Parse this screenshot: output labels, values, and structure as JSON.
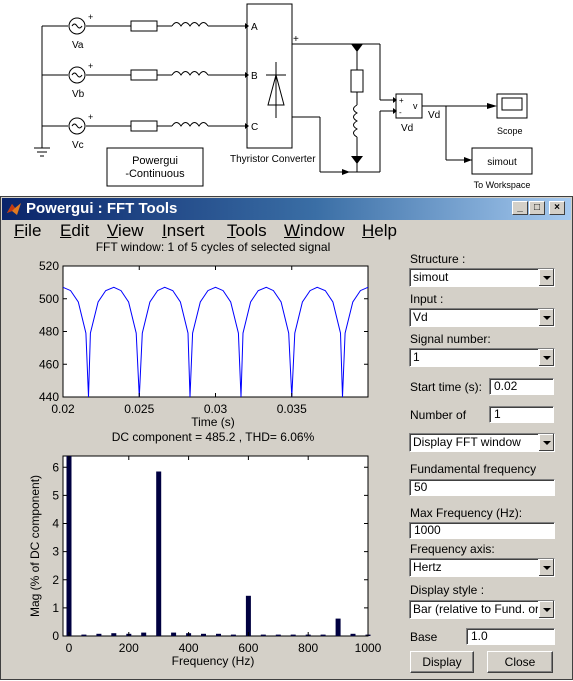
{
  "model": {
    "sources": [
      "Va",
      "Vb",
      "Vc"
    ],
    "converter_label": "Thyristor Converter",
    "ports": [
      "A",
      "B",
      "C"
    ],
    "plus_sign": "+",
    "minus_sign": "-",
    "powergui_line1": "Powergui",
    "powergui_line2": "-Continuous",
    "meter_label": "Vd",
    "meter_inner": "v",
    "signal_label": "Vd",
    "scope_label": "Scope",
    "workspace_block_text": "simout",
    "workspace_label": "To Workspace"
  },
  "window": {
    "title": "Powergui : FFT Tools",
    "menus": [
      "File",
      "Edit",
      "View",
      "Insert",
      "Tools",
      "Window",
      "Help"
    ]
  },
  "plots": {
    "top_title": "FFT window: 1 of 5 cycles of selected signal",
    "top_xlabel": "Time (s)",
    "bottom_title": "DC component = 485.2 , THD= 6.06%",
    "bottom_xlabel": "Frequency (Hz)",
    "bottom_ylabel": "Mag (% of DC component)"
  },
  "panel": {
    "structure_label": "Structure :",
    "structure_value": "simout",
    "input_label": "Input :",
    "input_value": "Vd",
    "signal_number_label": "Signal number:",
    "signal_number_value": "1",
    "start_time_label": "Start time (s):",
    "start_time_value": "0.02",
    "number_of_label": "Number of",
    "number_of_value": "1",
    "display_mode_value": "Display FFT window",
    "fundamental_label": "Fundamental frequency",
    "fundamental_value": "50",
    "max_freq_label": "Max Frequency (Hz):",
    "max_freq_value": "1000",
    "freq_axis_label": "Frequency axis:",
    "freq_axis_value": "Hertz",
    "display_style_label": "Display style :",
    "display_style_value": "Bar (relative to Fund. or DC)",
    "base_label": "Base",
    "base_value": "1.0",
    "display_button": "Display",
    "close_button": "Close"
  },
  "chart_data": [
    {
      "type": "line",
      "title": "FFT window: 1 of 5 cycles of selected signal",
      "xlabel": "Time (s)",
      "ylabel": "",
      "xlim": [
        0.02,
        0.04
      ],
      "ylim": [
        440,
        520
      ],
      "xticks": [
        "0.02",
        "0.025",
        "0.03",
        "0.035"
      ],
      "yticks": [
        "440",
        "460",
        "480",
        "500",
        "520"
      ],
      "series": [
        {
          "color": "#0000ff",
          "points": [
            [
              0.02,
              507
            ],
            [
              0.0205,
              505
            ],
            [
              0.021,
              498
            ],
            [
              0.0215,
              479
            ],
            [
              0.02167,
              440
            ],
            [
              0.0218,
              479
            ],
            [
              0.0223,
              498
            ],
            [
              0.0228,
              505
            ],
            [
              0.02333,
              507
            ],
            [
              0.0238,
              505
            ],
            [
              0.0243,
              498
            ],
            [
              0.0248,
              479
            ],
            [
              0.025,
              440
            ],
            [
              0.0252,
              479
            ],
            [
              0.0257,
              498
            ],
            [
              0.0262,
              505
            ],
            [
              0.02667,
              507
            ],
            [
              0.0272,
              505
            ],
            [
              0.0277,
              498
            ],
            [
              0.0282,
              479
            ],
            [
              0.02833,
              440
            ],
            [
              0.0285,
              479
            ],
            [
              0.029,
              498
            ],
            [
              0.0295,
              505
            ],
            [
              0.03,
              507
            ],
            [
              0.0305,
              505
            ],
            [
              0.031,
              498
            ],
            [
              0.0315,
              479
            ],
            [
              0.03167,
              440
            ],
            [
              0.0318,
              479
            ],
            [
              0.0323,
              498
            ],
            [
              0.0328,
              505
            ],
            [
              0.03333,
              507
            ],
            [
              0.0338,
              505
            ],
            [
              0.0343,
              498
            ],
            [
              0.0348,
              479
            ],
            [
              0.035,
              440
            ],
            [
              0.0352,
              479
            ],
            [
              0.0357,
              498
            ],
            [
              0.0362,
              505
            ],
            [
              0.03667,
              507
            ],
            [
              0.0372,
              505
            ],
            [
              0.0377,
              498
            ],
            [
              0.0382,
              479
            ],
            [
              0.03833,
              440
            ],
            [
              0.0385,
              479
            ],
            [
              0.039,
              498
            ],
            [
              0.0395,
              505
            ],
            [
              0.04,
              507
            ]
          ]
        }
      ]
    },
    {
      "type": "bar",
      "title": "DC component = 485.2 , THD= 6.06%",
      "xlabel": "Frequency (Hz)",
      "ylabel": "Mag (% of DC component)",
      "xlim": [
        -20,
        1000
      ],
      "ylim": [
        0,
        6.4
      ],
      "xticks": [
        "0",
        "200",
        "400",
        "600",
        "800",
        "1000"
      ],
      "yticks": [
        "0",
        "1",
        "2",
        "3",
        "4",
        "5",
        "6"
      ],
      "color": "#000040",
      "x": [
        0,
        50,
        100,
        150,
        200,
        250,
        300,
        350,
        400,
        450,
        500,
        550,
        600,
        650,
        700,
        750,
        800,
        850,
        900,
        950,
        1000
      ],
      "values": [
        6.4,
        0.05,
        0.08,
        0.1,
        0.08,
        0.12,
        5.85,
        0.12,
        0.1,
        0.08,
        0.08,
        0.05,
        1.43,
        0.05,
        0.05,
        0.05,
        0.05,
        0.05,
        0.62,
        0.08,
        0.05
      ]
    }
  ]
}
